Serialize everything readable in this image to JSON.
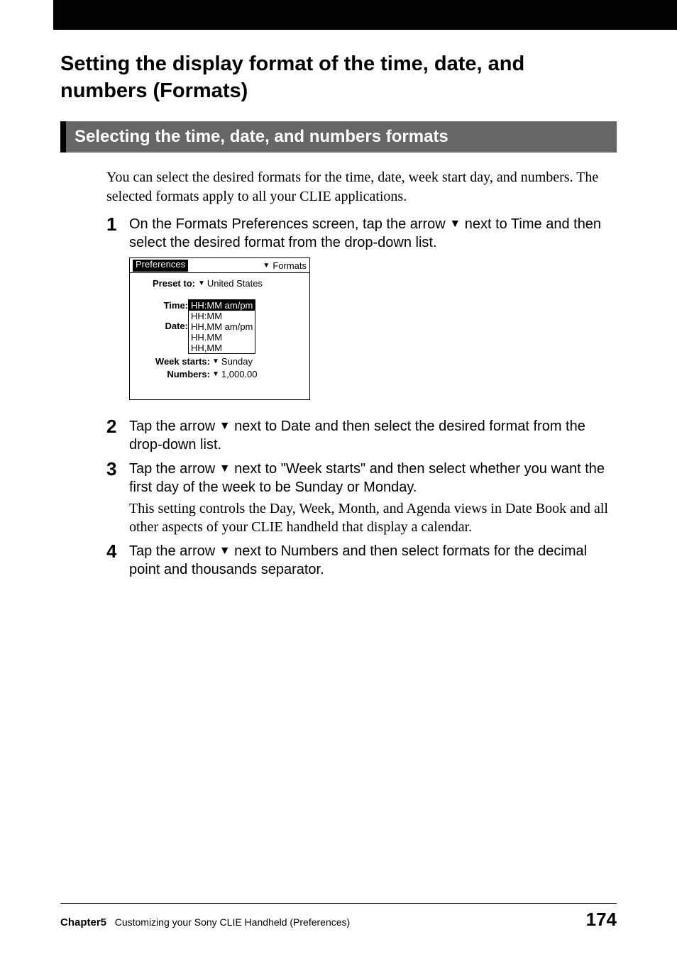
{
  "page_title": "Setting the display format of the time, date, and numbers (Formats)",
  "section_heading": "Selecting the time, date, and numbers formats",
  "intro": "You can select the desired formats for the time, date, week start day, and numbers. The selected formats apply to all your CLIE applications.",
  "steps": {
    "1": {
      "pre": "On the Formats Preferences screen, tap the arrow ",
      "post": " next to Time and then select the desired format from the drop-down list."
    },
    "2": {
      "pre": "Tap the arrow ",
      "post": " next to Date and then select the desired format from the drop-down list."
    },
    "3": {
      "pre": "Tap the arrow ",
      "post": " next to \"Week starts\" and then select whether you want the first day of the week to be Sunday or Monday.",
      "extra": "This setting controls the Day, Week, Month, and Agenda views in Date Book and all other aspects of your CLIE handheld that display a calendar."
    },
    "4": {
      "pre": "Tap the arrow ",
      "post": " next to Numbers and then select formats for the decimal point and thousands separator."
    }
  },
  "prefs_screen": {
    "header_left": "Preferences",
    "header_right": "Formats",
    "preset_label": "Preset to:",
    "preset_value": "United States",
    "time_label": "Time:",
    "date_label": "Date:",
    "dropdown": {
      "items": [
        "HH:MM am/pm",
        "HH:MM",
        "HH.MM am/pm",
        "HH.MM",
        "HH,MM"
      ],
      "selected_index": 0
    },
    "week_starts_label": "Week starts:",
    "week_starts_value": "Sunday",
    "numbers_label": "Numbers:",
    "numbers_value": "1,000.00"
  },
  "footer": {
    "chapter": "Chapter5",
    "chapter_title": "Customizing your Sony CLIE Handheld (Preferences)",
    "page_number": "174"
  },
  "glyphs": {
    "triangle": "▼"
  }
}
